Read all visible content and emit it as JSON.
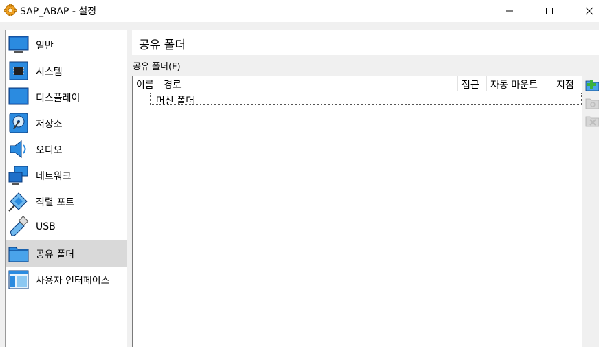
{
  "window": {
    "title": "SAP_ABAP - 설정"
  },
  "sidebar": {
    "items": [
      {
        "label": "일반",
        "icon": "monitor-icon"
      },
      {
        "label": "시스템",
        "icon": "chip-icon"
      },
      {
        "label": "디스플레이",
        "icon": "display-icon"
      },
      {
        "label": "저장소",
        "icon": "disk-icon"
      },
      {
        "label": "오디오",
        "icon": "speaker-icon"
      },
      {
        "label": "네트워크",
        "icon": "network-icon"
      },
      {
        "label": "직렬 포트",
        "icon": "serial-port-icon"
      },
      {
        "label": "USB",
        "icon": "usb-icon"
      },
      {
        "label": "공유 폴더",
        "icon": "folder-icon",
        "selected": true
      },
      {
        "label": "사용자 인터페이스",
        "icon": "window-layout-icon"
      }
    ]
  },
  "main": {
    "title": "공유 폴더",
    "group_label": "공유 폴더(F)",
    "columns": [
      "이름",
      "경로",
      "접근",
      "자동 마운트",
      "지점"
    ],
    "rows": [
      {
        "name": "머신 폴더"
      }
    ]
  },
  "toolbar": {
    "icons": [
      "add-folder-icon",
      "edit-folder-icon",
      "remove-folder-icon"
    ]
  },
  "colors": {
    "accent_blue": "#1e90d8",
    "selected_bg": "#d9d9d9",
    "add_green": "#3cb23c"
  }
}
